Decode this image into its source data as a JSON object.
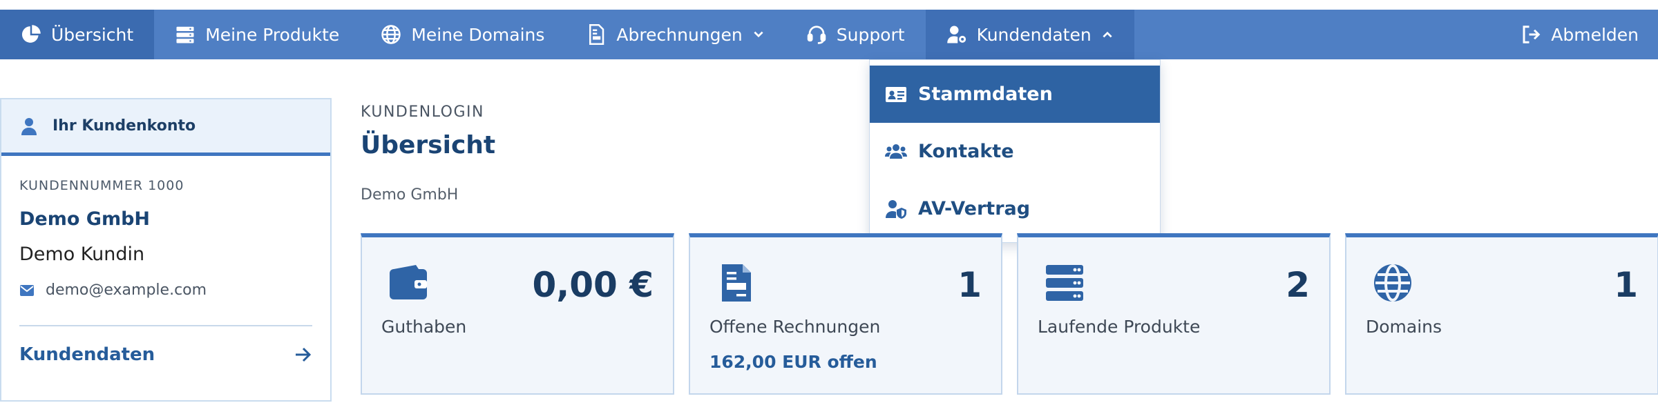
{
  "nav": {
    "items": [
      {
        "label": "Übersicht",
        "icon": "chart-pie-icon"
      },
      {
        "label": "Meine Produkte",
        "icon": "server-icon"
      },
      {
        "label": "Meine Domains",
        "icon": "globe-icon"
      },
      {
        "label": "Abrechnungen",
        "icon": "invoice-icon"
      },
      {
        "label": "Support",
        "icon": "headset-icon"
      },
      {
        "label": "Kundendaten",
        "icon": "user-cog-icon"
      }
    ],
    "logout": {
      "label": "Abmelden",
      "icon": "sign-out-icon"
    }
  },
  "dropdown": {
    "items": [
      {
        "label": "Stammdaten",
        "icon": "id-card-icon"
      },
      {
        "label": "Kontakte",
        "icon": "users-icon"
      },
      {
        "label": "AV-Vertrag",
        "icon": "user-shield-icon"
      }
    ]
  },
  "sidebar": {
    "header": "Ihr Kundenkonto",
    "customer_number": "KUNDENNUMMER 1000",
    "company": "Demo GmbH",
    "person": "Demo Kundin",
    "email": "demo@example.com",
    "link": "Kundendaten"
  },
  "main": {
    "breadcrumb": "KUNDENLOGIN",
    "title": "Übersicht",
    "subtitle": "Demo GmbH"
  },
  "cards": [
    {
      "value": "0,00 €",
      "label": "Guthaben",
      "icon": "wallet-icon"
    },
    {
      "value": "1",
      "label": "Offene Rechnungen",
      "sub": "162,00 EUR offen",
      "icon": "invoice-icon"
    },
    {
      "value": "2",
      "label": "Laufende Produkte",
      "icon": "server-icon"
    },
    {
      "value": "1",
      "label": "Domains",
      "icon": "globe-icon"
    }
  ],
  "colors": {
    "navbar": "#4f7fc4",
    "accent": "#3f76c0",
    "title": "#1a4474"
  }
}
